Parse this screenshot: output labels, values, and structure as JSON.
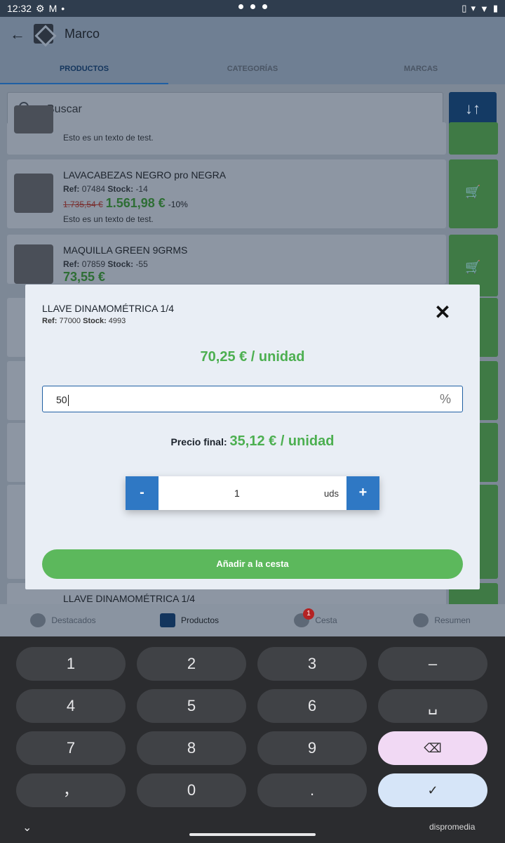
{
  "status": {
    "time": "12:32"
  },
  "app": {
    "title": "Marco",
    "tabs": [
      "PRODUCTOS",
      "CATEGORÍAS",
      "MARCAS"
    ],
    "search_placeholder": "Buscar"
  },
  "products": [
    {
      "name": "",
      "ref": "",
      "stock": "",
      "old_price": "",
      "price": "",
      "discount": "",
      "desc": "Esto es un texto de test."
    },
    {
      "name": "LAVACABEZAS NEGRO pro NEGRA",
      "ref": "07484",
      "stock": "-14",
      "old_price": "1.735,54 €",
      "price": "1.561,98 €",
      "discount": "-10%",
      "desc": "Esto es un texto de test."
    },
    {
      "name": "MAQUILLA GREEN 9GRMS",
      "ref": "07859",
      "stock": "-55",
      "old_price": "",
      "price": "73,55 €",
      "discount": "",
      "desc": ""
    },
    {
      "name": "LLAVE DINAMOMÉTRICA 1/4",
      "ref": "",
      "stock": "",
      "old_price": "",
      "price": "",
      "discount": "",
      "desc": ""
    }
  ],
  "labels": {
    "ref": "Ref:",
    "stock": "Stock:"
  },
  "bottom_nav": {
    "items": [
      "Destacados",
      "Productos",
      "Cesta",
      "Resumen"
    ],
    "cart_badge": "1"
  },
  "modal": {
    "title": "LLAVE DINAMOMÉTRICA 1/4",
    "ref": "77000",
    "stock": "4993",
    "unit_price": "70,25 € / unidad",
    "discount_value": "50",
    "pct_symbol": "%",
    "final_label": "Precio final:",
    "final_value": "35,12 € / unidad",
    "qty": "1",
    "qty_unit": "uds",
    "minus": "-",
    "plus": "+",
    "add_button": "Añadir a la cesta",
    "close": "✕"
  },
  "keyboard": {
    "keys": [
      "1",
      "2",
      "3",
      "–",
      "4",
      "5",
      "6",
      "␣",
      "7",
      "8",
      "9",
      "⌫",
      "，",
      "0",
      ".",
      "✓"
    ],
    "watermark": "dispromedia"
  }
}
